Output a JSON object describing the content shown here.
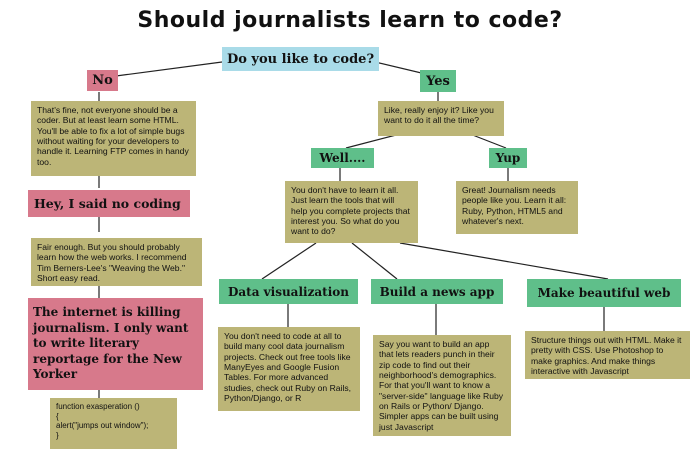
{
  "title": "Should journalists learn to code?",
  "question": "Do you like to code?",
  "no_branch": {
    "label": "No",
    "note1": "That's fine, not everyone should be a coder. But at least learn some HTML. You'll be able to fix a lot of simple bugs without waiting for your developers to handle it. Learning FTP comes in handy too.",
    "label2": "Hey, I said no coding",
    "note2": "Fair enough. But you should probably learn how the web works. I recommend Tim Berners-Lee's \"Weaving the Web.\" Short easy read.",
    "label3": "The internet is killing journalism. I only want to write literary reportage for the New Yorker",
    "code": "function exasperation ()\n  {\n    alert(\"jumps out window\");\n  }"
  },
  "yes_branch": {
    "label": "Yes",
    "question2": "Like, really enjoy it? Like you want to do it all the time?",
    "well_label": "Well....",
    "well_note": "You don't have to learn it all. Just learn the tools that will help you complete projects that interest you. So what do you want to do?",
    "yup_label": "Yup",
    "yup_note": "Great! Journalism needs people like you. Learn it all: Ruby, Python, HTML5 and whatever's next."
  },
  "paths": [
    {
      "label": "Data visualization",
      "note": "You don't need to code at all to build many cool data journalism projects. Check out free tools like ManyEyes and Google Fusion Tables. For more advanced studies, check out Ruby on Rails, Python/Django, or R"
    },
    {
      "label": "Build a news app",
      "note": "Say you want to build an app that lets readers punch in their zip code to find out their neighborhood's demographics. For that you'll want to know a \"server-side\" language like Ruby on Rails or Python/ Django. Simpler apps can be built using just Javascript"
    },
    {
      "label": "Make beautiful web",
      "note": "Structure things out with HTML. Make it pretty with CSS. Use Photoshop to make graphics. And make things interactive with Javascript"
    }
  ],
  "colors": {
    "question": "#a9dbe8",
    "no": "#d7798b",
    "yes": "#5fbf8a",
    "note": "#bcb577"
  }
}
